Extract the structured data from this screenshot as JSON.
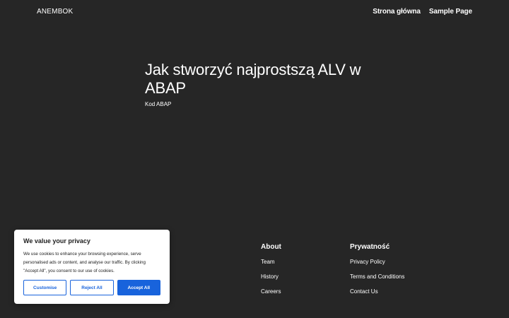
{
  "header": {
    "logo": "ANEMBOK",
    "nav": [
      "Strona główna",
      "Sample Page"
    ]
  },
  "post": {
    "title": "Jak stworzyć najprostszą ALV w ABAP",
    "category": "Kod ABAP"
  },
  "footer": {
    "about": {
      "heading": "About",
      "links": [
        "Team",
        "History",
        "Careers"
      ]
    },
    "privacy": {
      "heading": "Prywatność",
      "links": [
        "Privacy Policy",
        "Terms and Conditions",
        "Contact Us"
      ]
    }
  },
  "consent": {
    "title": "We value your privacy",
    "text": "We use cookies to enhance your browsing experience, serve personalised ads or content, and analyse our traffic. By clicking \"Accept All\", you consent to our use of cookies.",
    "customise": "Customise",
    "reject": "Reject All",
    "accept": "Accept All",
    "accent_color": "#1863dc"
  },
  "colors": {
    "background": "#262626",
    "text": "#ffffff"
  }
}
